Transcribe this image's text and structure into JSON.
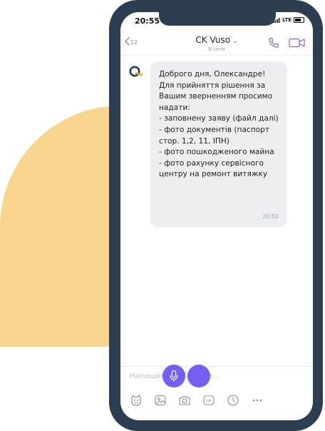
{
  "status_bar": {
    "time": "20:55",
    "network": "LTE"
  },
  "header": {
    "back_count": "12",
    "title": "CK Vuso",
    "title_caret": "⌄",
    "subtitle": "В сети"
  },
  "message": {
    "text": "Доброго дня, Олександре!\nДля прийняття рішення за Вашим зверненням просимо надати:\n- заповнену заяву (файл далі)\n- фото документів (паспорт стор. 1,2, 11, ІПН)\n- фото пошкодженого майна\n- фото рахунку сервісного центру на ремонт витяжку",
    "time": "20:52"
  },
  "composer": {
    "placeholder": "Напишите сообщение..."
  },
  "icons": {
    "back": "chevron-left-icon",
    "call": "phone-icon",
    "video": "video-camera-icon",
    "toolbar": [
      "sticker-icon",
      "gallery-icon",
      "camera-icon",
      "gif-icon",
      "clock-icon",
      "more-icon"
    ],
    "send": "microphone-icon"
  },
  "colors": {
    "accent": "#7360f2",
    "phone_frame": "#2d3e53",
    "blob": "#f8d58e",
    "bubble": "#eceef1",
    "brand_orange": "#f5a623",
    "brand_navy": "#1c3a6b"
  }
}
